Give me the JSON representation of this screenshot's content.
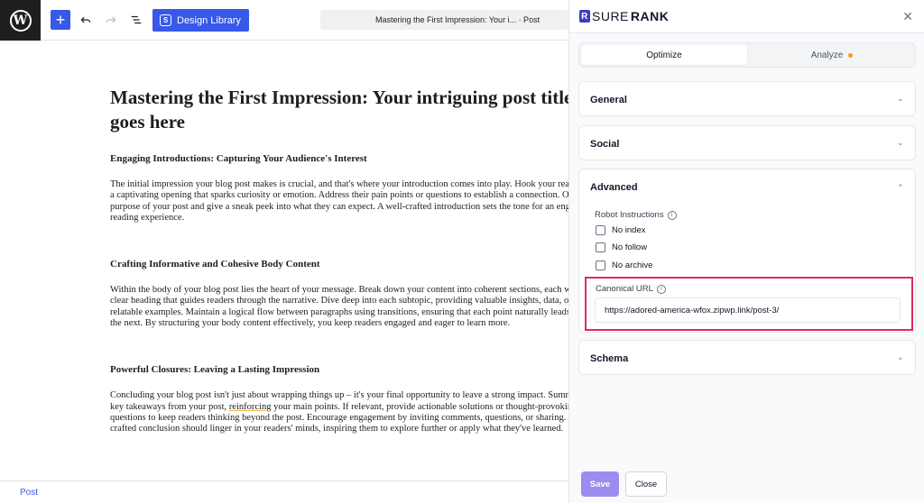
{
  "toolbar": {
    "design_library_label": "Design Library",
    "document_title": "Mastering the First Impression: Your i... · Post"
  },
  "post": {
    "title": "Mastering the First Impression: Your intriguing post title goes here",
    "sections": [
      {
        "heading": "Engaging Introductions: Capturing Your Audience's Interest",
        "lines": [
          "The initial impression your blog post makes is crucial, and that's where your introduction comes into play. Hook your readers with",
          "a captivating opening that sparks curiosity or emotion. Address their pain points or questions to establish a connection. Outline the",
          "purpose of your post and give a sneak peek into what they can expect. A well-crafted introduction sets the tone for an engaging",
          "reading experience."
        ]
      },
      {
        "heading": "Crafting Informative and Cohesive Body Content",
        "lines": [
          "Within the body of your blog post lies the heart of your message. Break down your content into coherent sections, each with a",
          "clear heading that guides readers through the narrative. Dive deep into each subtopic, providing valuable insights, data, or",
          "relatable examples. Maintain a logical flow between paragraphs using transitions, ensuring that each point naturally leads to",
          "the next. By structuring your body content effectively, you keep readers engaged and eager to learn more."
        ]
      },
      {
        "heading": "Powerful Closures: Leaving a Lasting Impression",
        "line1": "Concluding your blog post isn't just about wrapping things up – it's your final opportunity to leave a strong impact. Summarize the",
        "line2_before": "key takeaways from your post, ",
        "line2_underlined": "reinforcing",
        "line2_after": " your main points. If relevant, provide actionable solutions or thought-provoking",
        "line3": "questions to keep readers thinking beyond the post. Encourage engagement by inviting comments, questions, or sharing. A well-",
        "line4": "crafted conclusion should linger in your readers' minds, inspiring them to explore further or apply what they've learned."
      }
    ]
  },
  "footer": {
    "breadcrumb": "Post"
  },
  "sidebar": {
    "brand_sure": "SURE",
    "brand_rank": "RANK",
    "tabs": {
      "optimize": "Optimize",
      "analyze": "Analyze"
    },
    "general_label": "General",
    "social_label": "Social",
    "advanced_label": "Advanced",
    "robot_instructions_label": "Robot Instructions",
    "checkbox_no_index": "No index",
    "checkbox_no_follow": "No follow",
    "checkbox_no_archive": "No archive",
    "canonical_label": "Canonical URL",
    "canonical_value": "https://adored-america-wfox.zipwp.link/post-3/",
    "schema_label": "Schema",
    "save_label": "Save",
    "close_label": "Close",
    "accent_color": "#dc2c5c",
    "brand_color": "#4338ca"
  }
}
